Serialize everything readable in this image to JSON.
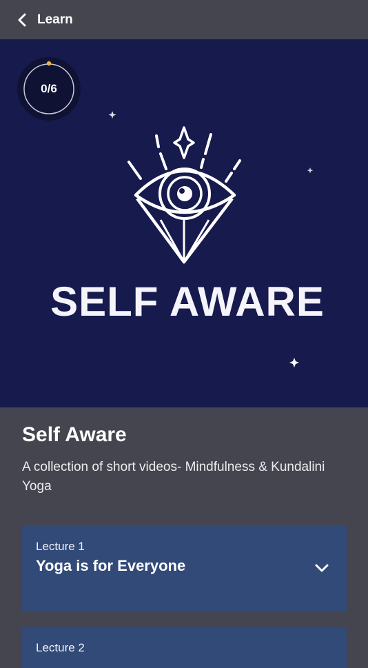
{
  "header": {
    "back_icon": "chevron-left-icon",
    "title": "Learn"
  },
  "hero": {
    "progress_text": "0/6",
    "progress_fraction": 0,
    "banner_text": "SELF AWARE",
    "background_color": "#171a4d",
    "illustration": "eye-diamond-icon"
  },
  "course": {
    "title": "Self Aware",
    "description": "A collection of short videos- Mindfulness & Kundalini Yoga"
  },
  "lectures": [
    {
      "number": "Lecture 1",
      "title": "Yoga is for Everyone",
      "expand_icon": "chevron-down-icon"
    },
    {
      "number": "Lecture 2"
    }
  ],
  "colors": {
    "app_background": "#45454f",
    "card_background": "#324a78",
    "progress_dot": "#f2b33d"
  }
}
